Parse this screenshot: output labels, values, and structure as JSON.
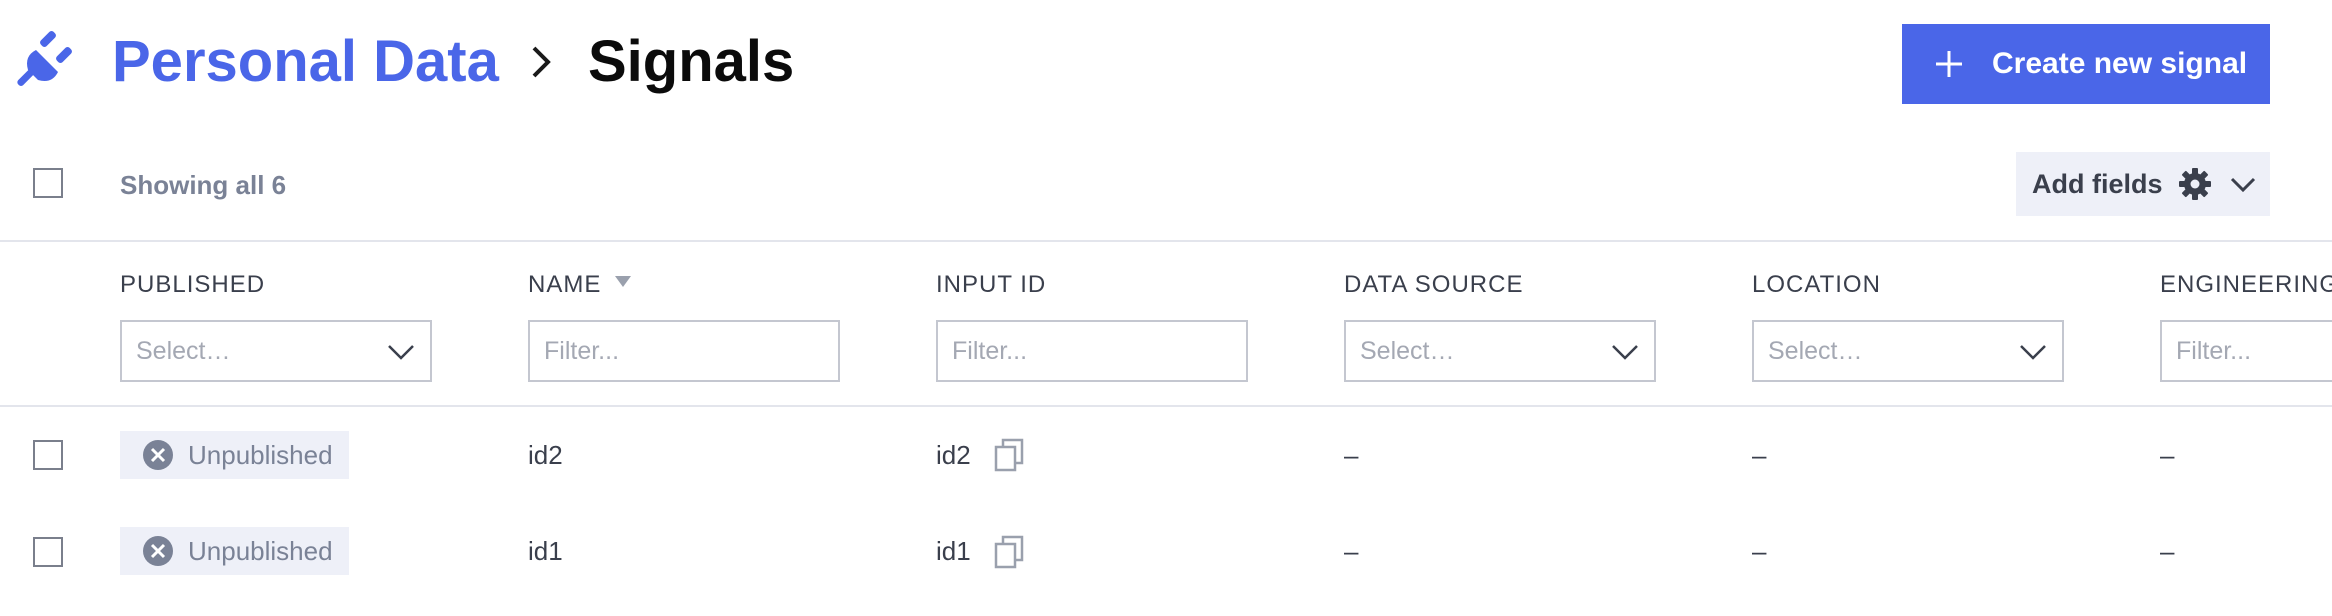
{
  "header": {
    "parent": "Personal Data",
    "current": "Signals",
    "create_button": "Create new signal"
  },
  "toolbar": {
    "showing": "Showing all 6",
    "add_fields": "Add fields"
  },
  "columns": {
    "published": "PUBLISHED",
    "name": "NAME",
    "input_id": "INPUT ID",
    "data_source": "DATA SOURCE",
    "location": "LOCATION",
    "engineering": "ENGINEERING I"
  },
  "filters": {
    "select_placeholder": "Select…",
    "filter_placeholder": "Filter..."
  },
  "rows": [
    {
      "status": "Unpublished",
      "name": "id2",
      "input_id": "id2",
      "data_source": "–",
      "location": "–",
      "engineering": "–"
    },
    {
      "status": "Unpublished",
      "name": "id1",
      "input_id": "id1",
      "data_source": "–",
      "location": "–",
      "engineering": "–"
    }
  ],
  "colors": {
    "accent": "#4a66e8",
    "muted_text": "#7a8296",
    "chip_bg": "#eef0f8"
  }
}
